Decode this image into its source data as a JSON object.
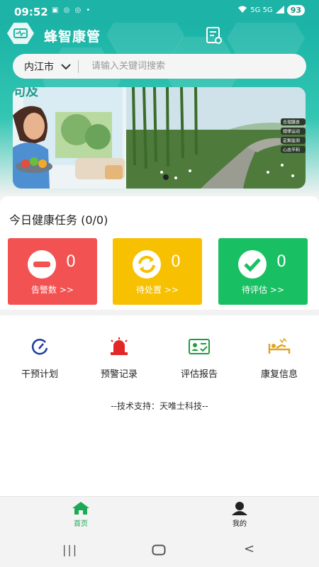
{
  "status_bar": {
    "time": "09:52",
    "notifications": "▣ ◎ ◎ •",
    "signal": "5G 5G",
    "battery": "93"
  },
  "header": {
    "app_name": "蜂智康管"
  },
  "search": {
    "city": "内江市",
    "placeholder": "请输入关键词搜索"
  },
  "banner": {
    "overlay_text": "句及",
    "tags": [
      "合理膳食",
      "规律运动",
      "定期监测",
      "心态平和"
    ]
  },
  "tasks": {
    "title": "今日健康任务 (0/0)",
    "cards": [
      {
        "count": "0",
        "label": "告警数 >>",
        "color": "#f25252"
      },
      {
        "count": "0",
        "label": "待处置 >>",
        "color": "#f7c000"
      },
      {
        "count": "0",
        "label": "待评估 >>",
        "color": "#19c063"
      }
    ]
  },
  "quick_actions": [
    {
      "label": "干预计划",
      "icon": "gauge-icon"
    },
    {
      "label": "预警记录",
      "icon": "alarm-light-icon"
    },
    {
      "label": "评估报告",
      "icon": "report-card-icon"
    },
    {
      "label": "康复信息",
      "icon": "rehab-bed-icon"
    }
  ],
  "support_text": "--技术支持：天唯士科技--",
  "tabbar": {
    "home": "首页",
    "mine": "我的",
    "active_color": "#1aaa55"
  },
  "system_nav": {
    "recent": "|||",
    "back": "<"
  }
}
